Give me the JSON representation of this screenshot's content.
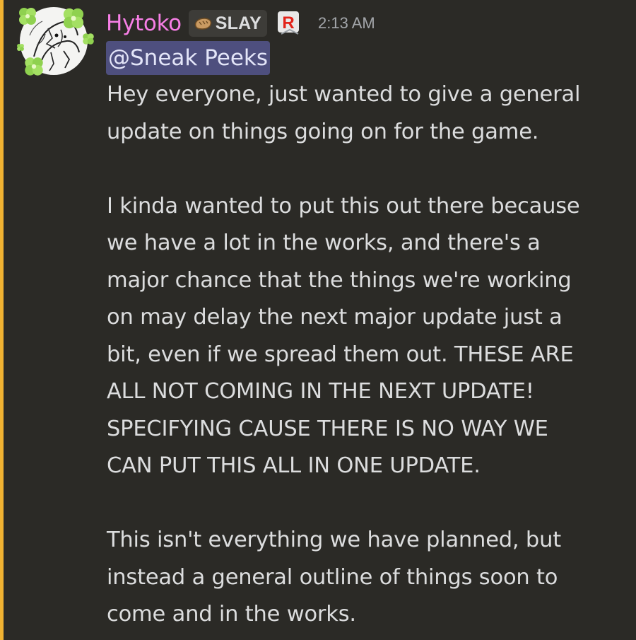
{
  "message": {
    "author": "Hytoko",
    "tag": {
      "icon": "bread-icon",
      "label": "SLAY"
    },
    "role_icon": "roblox-icon",
    "timestamp": "2:13 AM",
    "mention": "@Sneak Peeks",
    "paragraphs": [
      {
        "lines": [
          "Hey everyone, just wanted to give a general",
          "update on things going on for the game."
        ]
      },
      {
        "lines": [
          "I kinda wanted to put this out there because",
          "we have a lot in the works, and there's a",
          "major chance that the things we're working",
          "on may delay the next major update just a",
          "bit, even if we spread them out. THESE ARE",
          "ALL NOT COMING IN THE NEXT UPDATE!",
          "SPECIFYING CAUSE THERE IS NO WAY WE",
          "CAN PUT THIS ALL IN ONE UPDATE."
        ]
      },
      {
        "lines": [
          "This isn't everything we have planned, but",
          "instead a general outline of things soon to",
          "come and in the works."
        ]
      }
    ]
  },
  "colors": {
    "background": "#2b2a26",
    "mention_bar": "#f0b232",
    "username": "#f77fe6",
    "mention_bg": "#4e4f7e",
    "text": "#dcddde",
    "timestamp": "#a3a6aa"
  }
}
